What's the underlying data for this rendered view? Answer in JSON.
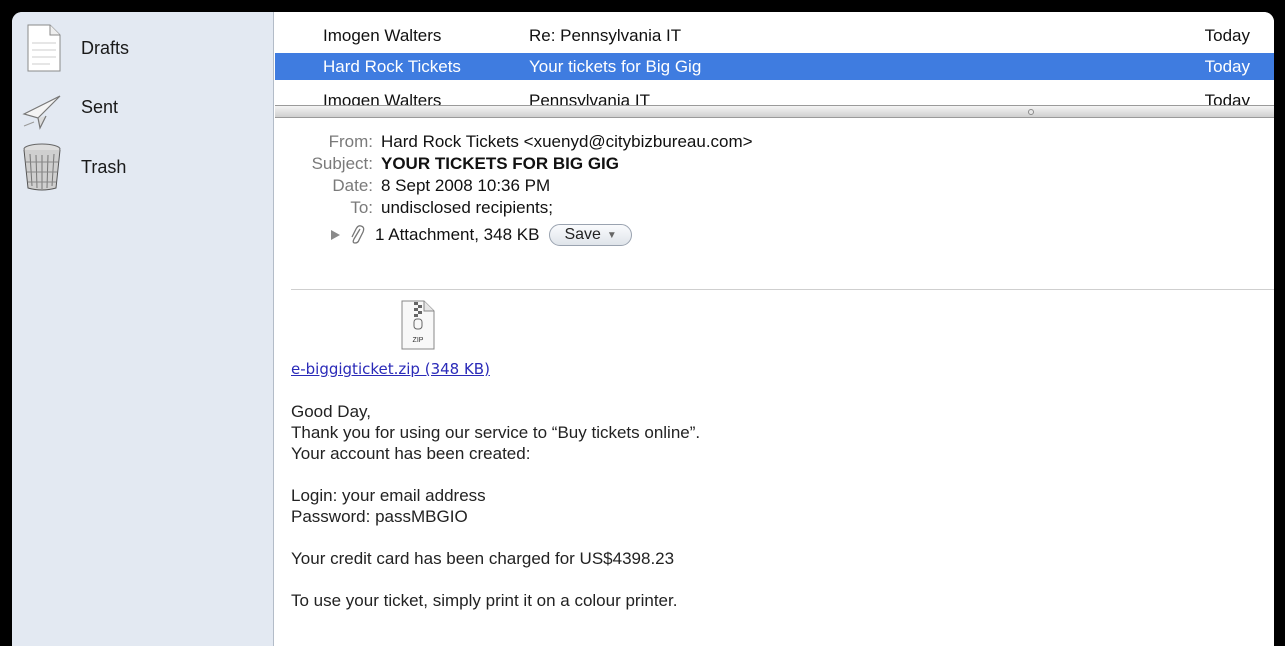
{
  "sidebar": {
    "mailboxes": [
      {
        "label": "Drafts",
        "icon": "drafts-icon"
      },
      {
        "label": "Sent",
        "icon": "sent-icon"
      },
      {
        "label": "Trash",
        "icon": "trash-icon"
      }
    ]
  },
  "message_list": {
    "rows": [
      {
        "from": "Imogen Walters",
        "subject": "Re: Pennsylvania IT",
        "date": "Today",
        "selected": false
      },
      {
        "from": "Hard Rock Tickets",
        "subject": "Your tickets for Big Gig",
        "date": "Today",
        "selected": true
      },
      {
        "from": "Imogen Walters",
        "subject": "Pennsylvania IT",
        "date": "Today",
        "selected": false
      }
    ]
  },
  "message": {
    "from_label": "From:",
    "from_value": "Hard Rock Tickets <xuenyd@citybizbureau.com>",
    "subject_label": "Subject:",
    "subject_value": "YOUR TICKETS FOR BIG GIG",
    "date_label": "Date:",
    "date_value": "8 Sept 2008  10:36 PM",
    "to_label": "To:",
    "to_value": "undisclosed recipients;",
    "attachment_summary": "1 Attachment, 348 KB",
    "save_label": "Save",
    "zip_icon_text": "ZIP",
    "attachment_link": "e-biggigticket.zip (348 KB)",
    "body": {
      "greeting": "Good Day,",
      "line1": "Thank you for using our service to “Buy tickets online”.",
      "line2": "Your account has been created:",
      "login": "Login:  your email address",
      "password": "Password:  passMBGIO",
      "charged": "Your credit card has been charged for US$4398.23",
      "print": "To use your ticket, simply print it on a colour printer."
    }
  },
  "colors": {
    "selection": "#3f7ce0",
    "sidebar_bg": "#e3e9f2",
    "link": "#2a2ab8"
  }
}
